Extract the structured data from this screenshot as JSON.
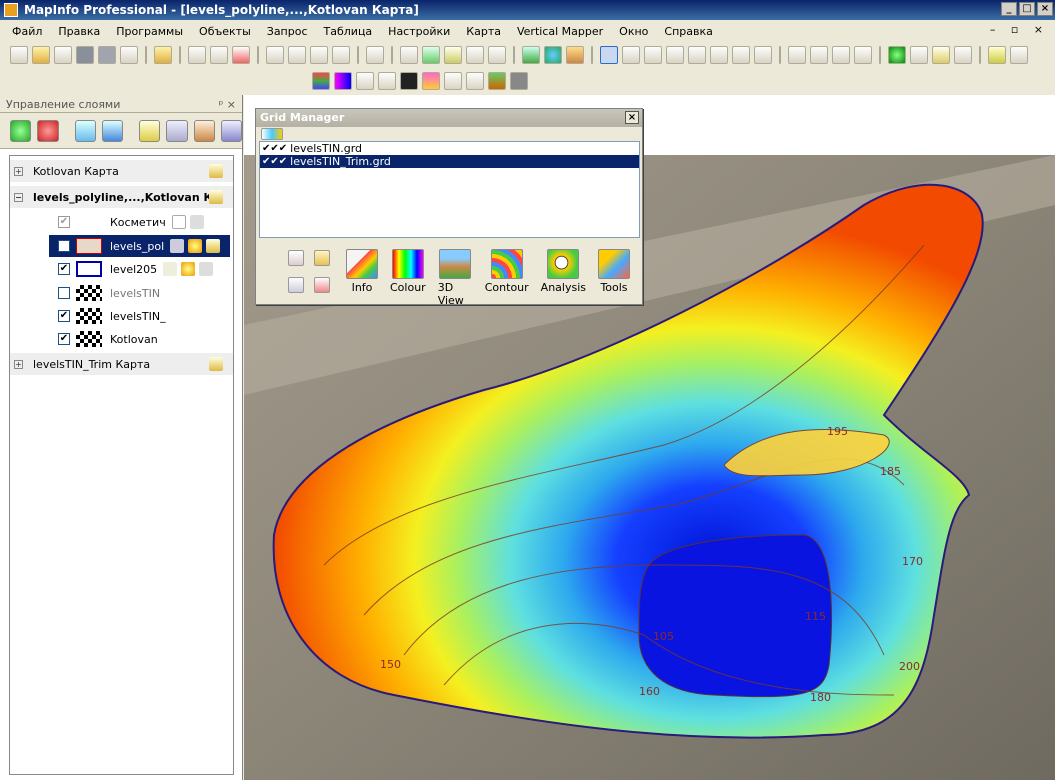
{
  "window": {
    "title": "MapInfo Professional - [levels_polyline,...,Kotlovan Карта]",
    "controls": [
      "_",
      "□",
      "×"
    ],
    "mdi_controls": "– ▫ ×"
  },
  "menu": [
    "Файл",
    "Правка",
    "Программы",
    "Объекты",
    "Запрос",
    "Таблица",
    "Настройки",
    "Карта",
    "Vertical Mapper",
    "Окно",
    "Справка"
  ],
  "layer_panel": {
    "title": "Управление слоями",
    "pin": "ᵖ ×",
    "layers": [
      {
        "label": "Kotlovan Карта",
        "expander": "+"
      },
      {
        "label": "levels_polyline,...,Kotlovan К",
        "expander": "−"
      },
      {
        "label": "Косметич"
      },
      {
        "label": "levels_pol"
      },
      {
        "label": "level205"
      },
      {
        "label": "levelsTIN"
      },
      {
        "label": "levelsTIN_"
      },
      {
        "label": "Kotlovan"
      },
      {
        "label": "levelsTIN_Trim Карта",
        "expander": "+"
      }
    ]
  },
  "grid_manager": {
    "title": "Grid Manager",
    "close": "×",
    "files": [
      {
        "checks": "✔✔✔",
        "name": "levelsTIN.grd"
      },
      {
        "checks": "✔✔✔",
        "name": "levelsTIN_Trim.grd"
      }
    ],
    "buttons": [
      "Info",
      "Colour",
      "3D View",
      "Contour",
      "Analysis",
      "Tools"
    ]
  },
  "map": {
    "contour_labels": [
      "195",
      "185",
      "170",
      "150",
      "115",
      "105",
      "160",
      "180",
      "200"
    ]
  }
}
